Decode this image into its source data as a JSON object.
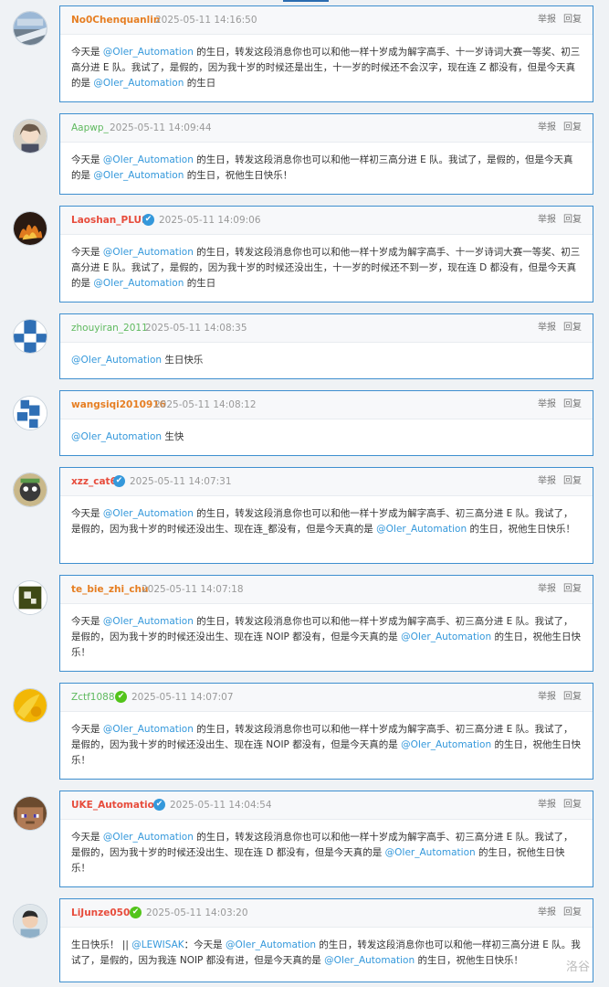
{
  "actions": {
    "report": "举报",
    "reply": "回复"
  },
  "watermark": "洛谷",
  "posts": [
    {
      "user": "No0Chenquanlin",
      "time": "2025-05-11 14:16:50",
      "verified": null,
      "body": [
        {
          "t": "今天是 "
        },
        {
          "m": "@OIer_Automation"
        },
        {
          "t": " 的生日，转发这段消息你也可以和他一样十岁成为解字高手、十一岁诗词大赛一等奖、初三高分进 E 队。我试了，是假的，因为我十岁的时候还是出生，十一岁的时候还不会汉字，现在连 Z 都没有，但是今天真的是 "
        },
        {
          "m": "@OIer_Automation"
        },
        {
          "t": " 的生日"
        }
      ]
    },
    {
      "user": "Aapwp_",
      "time": "2025-05-11 14:09:44",
      "verified": null,
      "body": [
        {
          "t": "今天是 "
        },
        {
          "m": "@OIer_Automation"
        },
        {
          "t": " 的生日，转发这段消息你也可以和他一样初三高分进 E 队。我试了，是假的，但是今天真的是 "
        },
        {
          "m": "@OIer_Automation"
        },
        {
          "t": " 的生日，祝他生日快乐！"
        }
      ]
    },
    {
      "user": "Laoshan_PLUS",
      "time": "2025-05-11 14:09:06",
      "verified": "blue",
      "body": [
        {
          "t": "今天是 "
        },
        {
          "m": "@OIer_Automation"
        },
        {
          "t": " 的生日，转发这段消息你也可以和他一样十岁成为解字高手、十一岁诗词大赛一等奖、初三高分进 E 队。我试了，是假的，因为我十岁的时候还没出生，十一岁的时候还不到一岁，现在连 D 都没有，但是今天真的是 "
        },
        {
          "m": "@OIer_Automation"
        },
        {
          "t": " 的生日"
        }
      ]
    },
    {
      "user": "zhouyiran_2011",
      "time": "2025-05-11 14:08:35",
      "verified": null,
      "body": [
        {
          "m": "@OIer_Automation"
        },
        {
          "t": " 生日快乐"
        }
      ]
    },
    {
      "user": "wangsiqi2010916",
      "time": "2025-05-11 14:08:12",
      "verified": null,
      "body": [
        {
          "m": "@OIer_Automation"
        },
        {
          "t": " 生快"
        }
      ]
    },
    {
      "user": "xzz_cat6",
      "time": "2025-05-11 14:07:31",
      "verified": "blue",
      "body": [
        {
          "t": "今天是 "
        },
        {
          "m": "@OIer_Automation"
        },
        {
          "t": " 的生日，转发这段消息你也可以和他一样十岁成为解字高手、初三高分进 E 队。我试了，是假的，因为我十岁的时候还没出生、现在连_都没有，但是今天真的是 "
        },
        {
          "m": "@OIer_Automation"
        },
        {
          "t": " 的生日，祝他生日快乐！"
        }
      ]
    },
    {
      "user": "te_bie_zhi_chu",
      "time": "2025-05-11 14:07:18",
      "verified": null,
      "body": [
        {
          "t": "今天是 "
        },
        {
          "m": "@OIer_Automation"
        },
        {
          "t": " 的生日，转发这段消息你也可以和他一样十岁成为解字高手、初三高分进 E 队。我试了，是假的，因为我十岁的时候还没出生、现在连 NOIP 都没有，但是今天真的是 "
        },
        {
          "m": "@OIer_Automation"
        },
        {
          "t": " 的生日，祝他生日快乐！"
        }
      ]
    },
    {
      "user": "Zctf1088",
      "time": "2025-05-11 14:07:07",
      "verified": "green",
      "body": [
        {
          "t": "今天是 "
        },
        {
          "m": "@OIer_Automation"
        },
        {
          "t": " 的生日，转发这段消息你也可以和他一样十岁成为解字高手、初三高分进 E 队。我试了，是假的，因为我十岁的时候还没出生、现在连 NOIP 都没有，但是今天真的是 "
        },
        {
          "m": "@OIer_Automation"
        },
        {
          "t": " 的生日，祝他生日快乐！"
        }
      ]
    },
    {
      "user": "UKE_Automation",
      "time": "2025-05-11 14:04:54",
      "verified": "blue",
      "body": [
        {
          "t": "今天是 "
        },
        {
          "m": "@OIer_Automation"
        },
        {
          "t": " 的生日，转发这段消息你也可以和他一样十岁成为解字高手、初三高分进 E 队。我试了，是假的，因为我十岁的时候还没出生、现在连 D 都没有，但是今天真的是 "
        },
        {
          "m": "@OIer_Automation"
        },
        {
          "t": " 的生日，祝他生日快乐！"
        }
      ]
    },
    {
      "user": "LiJunze0501",
      "time": "2025-05-11 14:03:20",
      "verified": "green",
      "body": [
        {
          "t": "生日快乐！ || "
        },
        {
          "m": "@LEWISAK"
        },
        {
          "t": "：今天是 "
        },
        {
          "m": "@OIer_Automation"
        },
        {
          "t": " 的生日，转发这段消息你也可以和他一样初三高分进 E 队。我试了，是假的，因为我连 NOIP 都没有进，但是今天真的是 "
        },
        {
          "m": "@OIer_Automation"
        },
        {
          "t": " 的生日，祝他生日快乐！"
        }
      ]
    }
  ]
}
